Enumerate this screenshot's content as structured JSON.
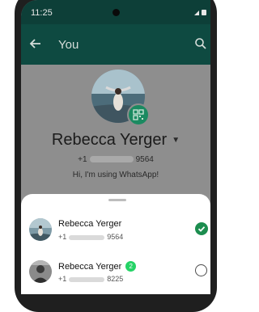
{
  "status_bar": {
    "time": "11:25"
  },
  "app_bar": {
    "title": "You"
  },
  "profile": {
    "name": "Rebecca Yerger",
    "phone_prefix": "+1",
    "phone_suffix": "9564",
    "status": "Hi, I'm using WhatsApp!"
  },
  "accounts": [
    {
      "name": "Rebecca Yerger",
      "phone_prefix": "+1",
      "phone_suffix": "9564",
      "selected": true
    },
    {
      "name": "Rebecca Yerger",
      "phone_prefix": "+1",
      "phone_suffix": "8225",
      "selected": false,
      "badge": "2"
    }
  ],
  "colors": {
    "app_bar": "#0e4a41",
    "accent": "#1c8d4f",
    "badge": "#25d366"
  }
}
